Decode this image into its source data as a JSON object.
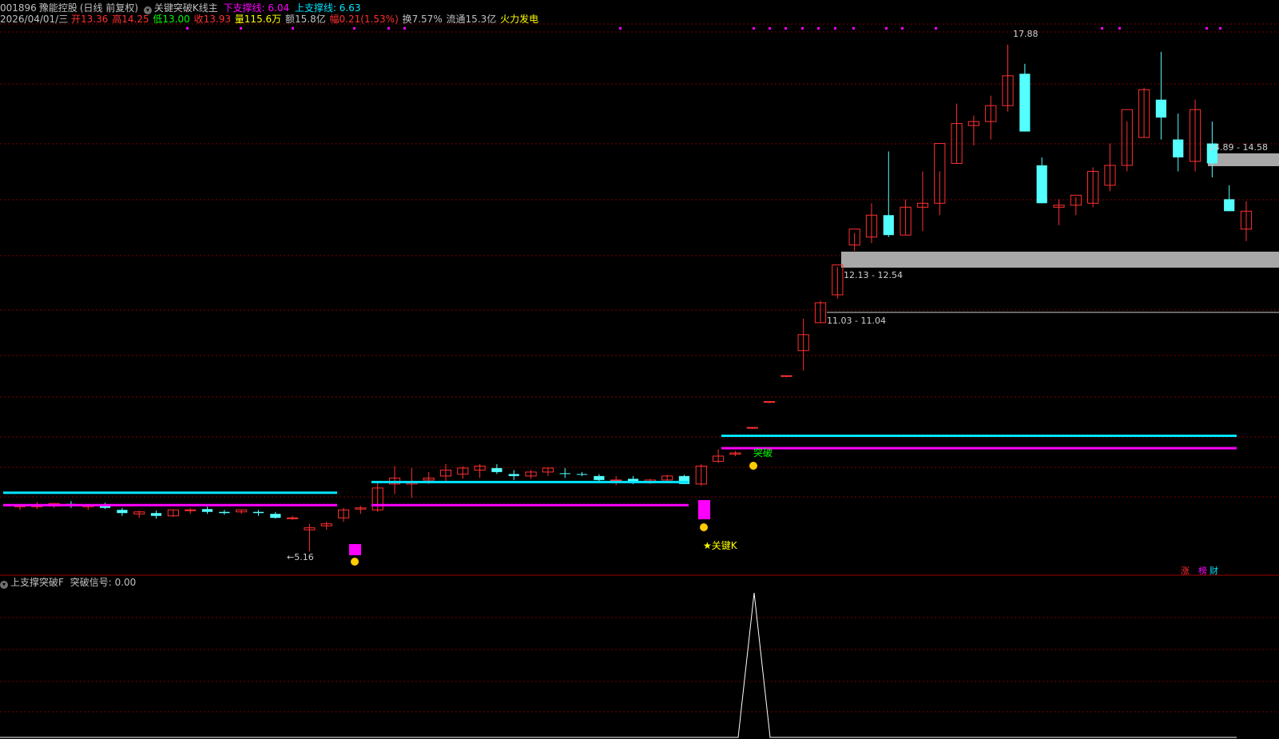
{
  "header": {
    "line1": {
      "code": "001896",
      "name": "豫能控股",
      "period": "(日线 前复权)",
      "indicator_name": "关键突破K线主",
      "lower_label": "下支撑线: 6.04",
      "upper_label": "上支撑线: 6.63"
    },
    "line2": {
      "date": "2026/04/01/三",
      "open": "开13.36",
      "high": "高14.25",
      "low": "低13.00",
      "close": "收13.93",
      "volume": "量115.6万",
      "amount": "额15.8亿",
      "change": "幅0.21(1.53%)",
      "turnover": "换7.57%",
      "float": "流通15.3亿",
      "concept": "火力发电"
    }
  },
  "annotations": {
    "high_price": "17.88",
    "low_price": "5.16",
    "zone_top": "14.89 - 14.58",
    "zone_mid": "12.13 - 12.54",
    "zone_low": "11.03 - 11.04",
    "breakout": "突破",
    "key_k": "★关键K",
    "corner_a": "涨",
    "corner_b": "榜",
    "corner_c": "财"
  },
  "sub_panel": {
    "title": "上支撑突破F",
    "signal": "突破信号: 0.00"
  },
  "colors": {
    "up": "#ff3030",
    "down": "#54ffff",
    "magenta": "#ff00ff",
    "cyan": "#00e5ff",
    "grid": "#8b0000",
    "zone": "#a8a8a8",
    "yellow": "#ffff00"
  },
  "chart_data": {
    "type": "candlestick",
    "price_range": [
      4.6,
      18.4
    ],
    "candles": [
      {
        "o": 6.28,
        "h": 6.35,
        "l": 6.2,
        "c": 6.3
      },
      {
        "o": 6.3,
        "h": 6.4,
        "l": 6.22,
        "c": 6.3
      },
      {
        "o": 6.3,
        "h": 6.36,
        "l": 6.25,
        "c": 6.36
      },
      {
        "o": 6.35,
        "h": 6.42,
        "l": 6.25,
        "c": 6.3
      },
      {
        "o": 6.28,
        "h": 6.34,
        "l": 6.2,
        "c": 6.32
      },
      {
        "o": 6.3,
        "h": 6.38,
        "l": 6.22,
        "c": 6.25
      },
      {
        "o": 6.2,
        "h": 6.25,
        "l": 6.05,
        "c": 6.12
      },
      {
        "o": 6.1,
        "h": 6.18,
        "l": 6.0,
        "c": 6.15
      },
      {
        "o": 6.12,
        "h": 6.18,
        "l": 5.98,
        "c": 6.05
      },
      {
        "o": 6.05,
        "h": 6.2,
        "l": 6.02,
        "c": 6.2
      },
      {
        "o": 6.18,
        "h": 6.24,
        "l": 6.1,
        "c": 6.2
      },
      {
        "o": 6.22,
        "h": 6.28,
        "l": 6.1,
        "c": 6.15
      },
      {
        "o": 6.15,
        "h": 6.2,
        "l": 6.08,
        "c": 6.12
      },
      {
        "o": 6.15,
        "h": 6.2,
        "l": 6.1,
        "c": 6.2
      },
      {
        "o": 6.15,
        "h": 6.2,
        "l": 6.05,
        "c": 6.12
      },
      {
        "o": 6.1,
        "h": 6.15,
        "l": 5.98,
        "c": 6.0
      },
      {
        "o": 6.0,
        "h": 6.05,
        "l": 5.95,
        "c": 6.0
      },
      {
        "o": 5.7,
        "h": 5.85,
        "l": 5.16,
        "c": 5.75
      },
      {
        "o": 5.8,
        "h": 5.9,
        "l": 5.7,
        "c": 5.85
      },
      {
        "o": 6.0,
        "h": 6.25,
        "l": 5.9,
        "c": 6.2
      },
      {
        "o": 6.22,
        "h": 6.3,
        "l": 6.1,
        "c": 6.25
      },
      {
        "o": 6.2,
        "h": 6.9,
        "l": 6.15,
        "c": 6.75
      },
      {
        "o": 6.85,
        "h": 7.3,
        "l": 6.6,
        "c": 7.0
      },
      {
        "o": 6.85,
        "h": 7.25,
        "l": 6.5,
        "c": 6.9
      },
      {
        "o": 6.95,
        "h": 7.15,
        "l": 6.85,
        "c": 7.0
      },
      {
        "o": 7.05,
        "h": 7.35,
        "l": 6.9,
        "c": 7.2
      },
      {
        "o": 7.1,
        "h": 7.3,
        "l": 6.98,
        "c": 7.25
      },
      {
        "o": 7.2,
        "h": 7.35,
        "l": 7.0,
        "c": 7.3
      },
      {
        "o": 7.25,
        "h": 7.35,
        "l": 7.1,
        "c": 7.15
      },
      {
        "o": 7.1,
        "h": 7.2,
        "l": 6.95,
        "c": 7.05
      },
      {
        "o": 7.05,
        "h": 7.2,
        "l": 6.98,
        "c": 7.15
      },
      {
        "o": 7.15,
        "h": 7.25,
        "l": 7.05,
        "c": 7.25
      },
      {
        "o": 7.12,
        "h": 7.25,
        "l": 7.0,
        "c": 7.1
      },
      {
        "o": 7.1,
        "h": 7.15,
        "l": 7.05,
        "c": 7.08
      },
      {
        "o": 7.05,
        "h": 7.1,
        "l": 6.92,
        "c": 6.95
      },
      {
        "o": 6.95,
        "h": 7.05,
        "l": 6.82,
        "c": 6.95
      },
      {
        "o": 6.98,
        "h": 7.05,
        "l": 6.85,
        "c": 6.88
      },
      {
        "o": 6.88,
        "h": 6.98,
        "l": 6.85,
        "c": 6.95
      },
      {
        "o": 6.95,
        "h": 7.08,
        "l": 6.92,
        "c": 7.05
      },
      {
        "o": 7.05,
        "h": 7.08,
        "l": 6.85,
        "c": 6.85
      },
      {
        "o": 6.85,
        "h": 7.35,
        "l": 6.8,
        "c": 7.3
      },
      {
        "o": 7.42,
        "h": 7.72,
        "l": 7.38,
        "c": 7.55
      },
      {
        "o": 7.6,
        "h": 7.68,
        "l": 7.55,
        "c": 7.63
      },
      {
        "o": 8.25,
        "h": 8.27,
        "l": 8.23,
        "c": 8.27
      },
      {
        "o": 8.9,
        "h": 8.92,
        "l": 8.88,
        "c": 8.92
      },
      {
        "o": 9.55,
        "h": 9.57,
        "l": 9.53,
        "c": 9.57
      },
      {
        "o": 10.2,
        "h": 11.0,
        "l": 9.7,
        "c": 10.6
      },
      {
        "o": 10.9,
        "h": 11.45,
        "l": 10.9,
        "c": 11.4
      },
      {
        "o": 11.6,
        "h": 12.3,
        "l": 11.5,
        "c": 12.35
      },
      {
        "o": 12.85,
        "h": 13.15,
        "l": 12.7,
        "c": 13.25
      },
      {
        "o": 13.05,
        "h": 13.9,
        "l": 12.9,
        "c": 13.6
      },
      {
        "o": 13.6,
        "h": 15.2,
        "l": 13.05,
        "c": 13.1
      },
      {
        "o": 13.1,
        "h": 14.0,
        "l": 13.1,
        "c": 13.8
      },
      {
        "o": 13.8,
        "h": 14.7,
        "l": 13.2,
        "c": 13.9
      },
      {
        "o": 13.9,
        "h": 14.7,
        "l": 13.6,
        "c": 15.4
      },
      {
        "o": 14.9,
        "h": 16.4,
        "l": 14.9,
        "c": 15.9
      },
      {
        "o": 15.85,
        "h": 16.1,
        "l": 15.35,
        "c": 15.95
      },
      {
        "o": 15.95,
        "h": 16.6,
        "l": 15.5,
        "c": 16.35
      },
      {
        "o": 16.35,
        "h": 17.88,
        "l": 16.2,
        "c": 17.1
      },
      {
        "o": 17.15,
        "h": 17.4,
        "l": 15.7,
        "c": 15.7
      },
      {
        "o": 14.85,
        "h": 15.05,
        "l": 13.9,
        "c": 13.9
      },
      {
        "o": 13.8,
        "h": 14.0,
        "l": 13.35,
        "c": 13.85
      },
      {
        "o": 13.85,
        "h": 14.05,
        "l": 13.6,
        "c": 14.1
      },
      {
        "o": 13.9,
        "h": 14.8,
        "l": 13.8,
        "c": 14.7
      },
      {
        "o": 14.35,
        "h": 15.4,
        "l": 14.2,
        "c": 14.85
      },
      {
        "o": 14.85,
        "h": 15.95,
        "l": 14.7,
        "c": 16.25
      },
      {
        "o": 15.55,
        "h": 16.8,
        "l": 15.55,
        "c": 16.75
      },
      {
        "o": 16.5,
        "h": 17.7,
        "l": 15.5,
        "c": 16.05
      },
      {
        "o": 15.5,
        "h": 16.15,
        "l": 14.7,
        "c": 15.05
      },
      {
        "o": 14.95,
        "h": 16.5,
        "l": 14.7,
        "c": 16.25
      },
      {
        "o": 15.4,
        "h": 15.95,
        "l": 14.55,
        "c": 14.9
      },
      {
        "o": 14.0,
        "h": 14.35,
        "l": 13.7,
        "c": 13.7
      },
      {
        "o": 13.25,
        "h": 13.95,
        "l": 12.95,
        "c": 13.7
      }
    ],
    "lower_support": 6.04,
    "upper_support": 6.63,
    "signal_series_peak": 1,
    "signal_baseline": 0
  }
}
